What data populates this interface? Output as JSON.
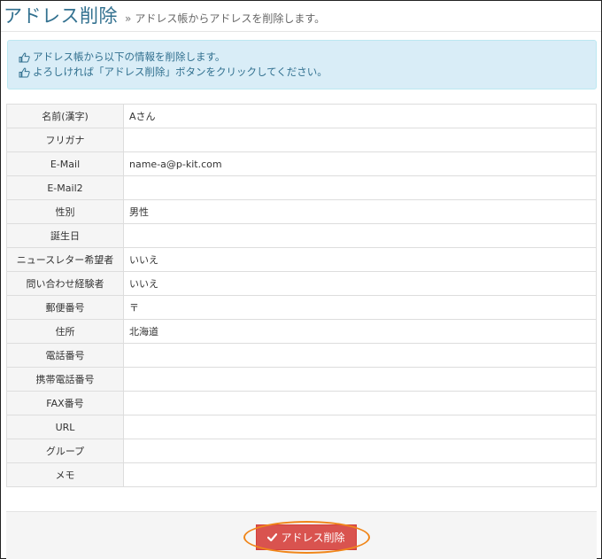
{
  "header": {
    "title": "アドレス削除",
    "subtitle_prefix": "»",
    "subtitle": "アドレス帳からアドレスを削除します。"
  },
  "alert": {
    "icon": "hand-pointing-icon",
    "lines": [
      "アドレス帳から以下の情報を削除します。",
      "よろしければ「アドレス削除」ボタンをクリックしてください。"
    ]
  },
  "fields": [
    {
      "label": "名前(漢字)",
      "value": "Aさん"
    },
    {
      "label": "フリガナ",
      "value": ""
    },
    {
      "label": "E-Mail",
      "value": "name-a@p-kit.com"
    },
    {
      "label": "E-Mail2",
      "value": ""
    },
    {
      "label": "性別",
      "value": "男性"
    },
    {
      "label": "誕生日",
      "value": ""
    },
    {
      "label": "ニュースレター希望者",
      "value": "いいえ"
    },
    {
      "label": "問い合わせ経験者",
      "value": "いいえ"
    },
    {
      "label": "郵便番号",
      "value": "〒"
    },
    {
      "label": "住所",
      "value": "北海道"
    },
    {
      "label": "電話番号",
      "value": ""
    },
    {
      "label": "携帯電話番号",
      "value": ""
    },
    {
      "label": "FAX番号",
      "value": ""
    },
    {
      "label": "URL",
      "value": ""
    },
    {
      "label": "グループ",
      "value": ""
    },
    {
      "label": "メモ",
      "value": ""
    }
  ],
  "footer": {
    "delete_button_label": "アドレス削除",
    "button_icon": "check-icon"
  },
  "colors": {
    "title": "#31708f",
    "alert_bg": "#d9edf7",
    "danger": "#d9534f",
    "highlight": "#f0861a"
  }
}
